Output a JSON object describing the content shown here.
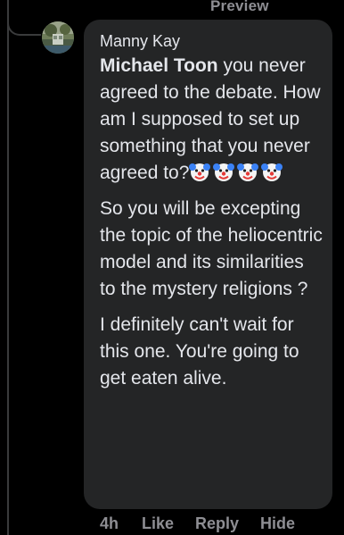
{
  "top": {
    "action_label": "Preview"
  },
  "comment": {
    "author": "Manny Kay",
    "mention": "Michael Toon",
    "paragraph1_text": " you never agreed to the debate. How am I supposed to set up something that you never agreed to?",
    "emoji_name": "clown-face-emoji",
    "emoji_count": 4,
    "paragraph2": "So you will be excepting the topic of the heliocentric model and its similarities to the mystery religions ?",
    "paragraph3": " I definitely can't wait for this one. You're going to get eaten alive."
  },
  "actions": {
    "time": "4h",
    "like": "Like",
    "reply": "Reply",
    "hide": "Hide"
  },
  "colors": {
    "background": "#000000",
    "bubble": "#242526",
    "text": "#e4e6eb",
    "muted": "#8e8e93"
  }
}
